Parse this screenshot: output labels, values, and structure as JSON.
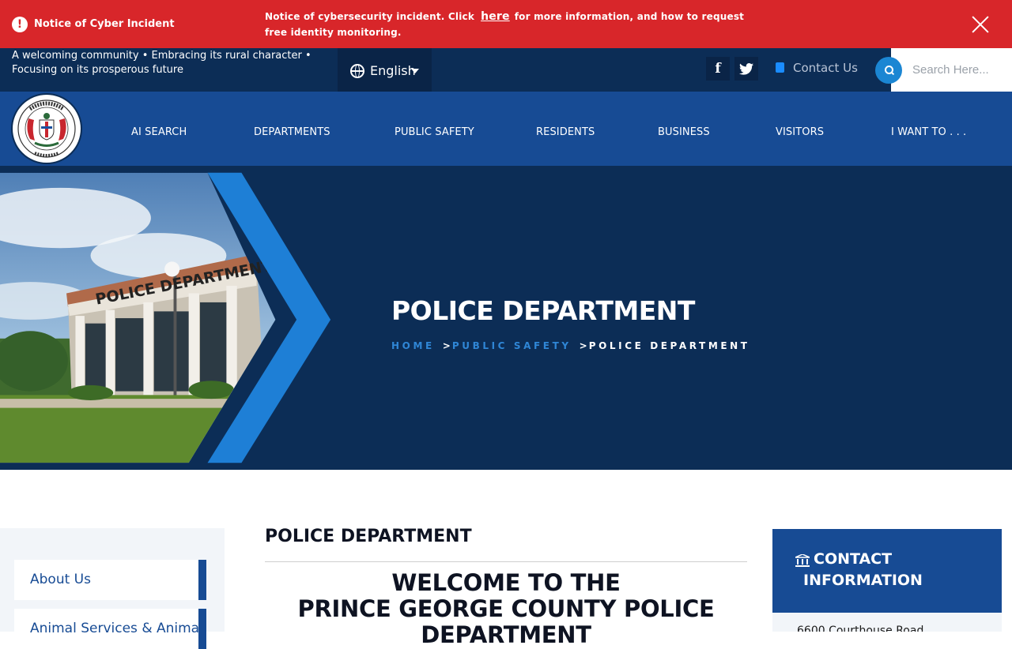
{
  "alert": {
    "title": "Notice of Cyber Incident",
    "message_before": "Notice of cybersecurity incident. Click",
    "link_text": "here",
    "message_after": "for more information, and how to request free identity monitoring.",
    "icon": "exclamation-icon",
    "close_icon": "close-icon",
    "background": "#d8262a"
  },
  "utility": {
    "tagline": "A welcoming community • Embracing its rural character • Focusing on its prosperous future",
    "language": "English",
    "facebook_glyph": "f",
    "twitter_glyph": "🐦",
    "contact_label": "Contact Us",
    "search_placeholder": "Search Here..."
  },
  "nav": {
    "logo": "county-seal",
    "items": [
      {
        "label": "AI SEARCH"
      },
      {
        "label": "DEPARTMENTS"
      },
      {
        "label": "PUBLIC SAFETY"
      },
      {
        "label": "RESIDENTS"
      },
      {
        "label": "BUSINESS"
      },
      {
        "label": "VISITORS"
      },
      {
        "label": "I WANT TO . . ."
      }
    ],
    "background": "#174b94"
  },
  "hero": {
    "title": "POLICE DEPARTMENT",
    "building_sign": "POLICE DEPARTMENT",
    "breadcrumb": [
      {
        "label": "HOME"
      },
      {
        "label": "PUBLIC SAFETY"
      },
      {
        "label": "POLICE DEPARTMENT"
      }
    ],
    "background": "#0c2d56",
    "accent": "#1e7fd6"
  },
  "sidebar": {
    "items": [
      {
        "label": "About Us"
      },
      {
        "label": "Animal Services & Animal Control"
      }
    ]
  },
  "main": {
    "title": "POLICE DEPARTMENT",
    "welcome_line1": "WELCOME TO THE",
    "welcome_line2": "PRINCE GEORGE COUNTY POLICE",
    "welcome_line3": "DEPARTMENT"
  },
  "contact": {
    "title": "CONTACT INFORMATION",
    "icon": "building-icon",
    "address": "6600 Courthouse Road"
  }
}
